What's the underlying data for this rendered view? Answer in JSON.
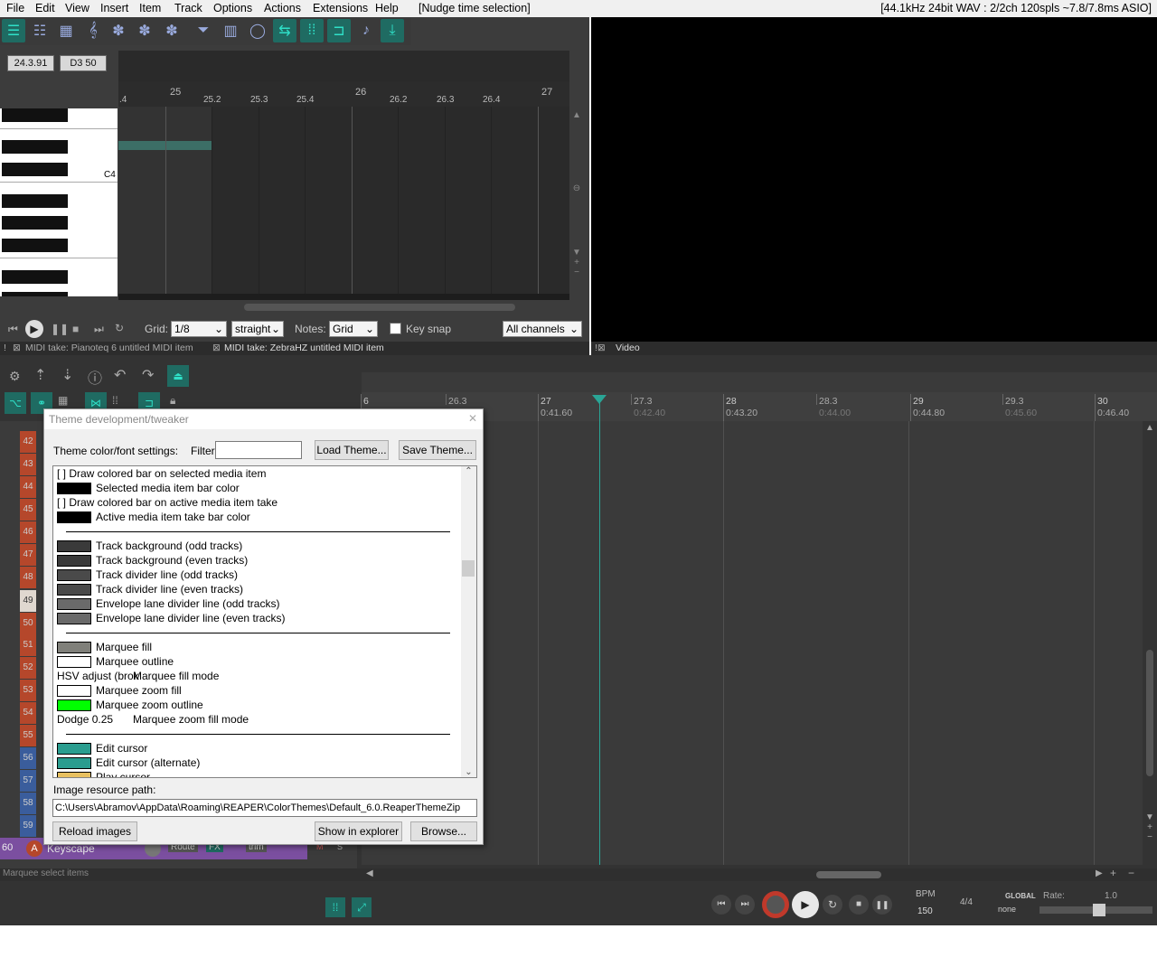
{
  "menu": {
    "items": [
      "File",
      "Edit",
      "View",
      "Insert",
      "Item",
      "Track",
      "Options",
      "Actions",
      "Extensions",
      "Help"
    ],
    "action_hint": "[Nudge time selection]",
    "audio_status": "[44.1kHz 24bit WAV : 2/2ch 120spls ~7.8/7.8ms ASIO]"
  },
  "midi_editor": {
    "position": "24.3.91",
    "note": "D3  50",
    "ruler": [
      "25",
      "25.2",
      "25.3",
      "25.4",
      "26",
      "26.2",
      "26.3",
      "26.4",
      "27"
    ],
    "ruler_partial": ".4",
    "key_label": "C4",
    "grid_label": "Grid:",
    "grid_value": "1/8",
    "grid_type": "straight",
    "notes_label": "Notes:",
    "notes_value": "Grid",
    "key_snap": "Key snap",
    "channels": "All channels"
  },
  "tabs_midi": [
    "MIDI take: Pianoteq 6 untitled MIDI item",
    "MIDI take: ZebraHZ untitled MIDI item"
  ],
  "tab_video": "Video",
  "timeline": {
    "marks": [
      {
        "bar": "6",
        "time": ""
      },
      {
        "bar": "26.3",
        "time": ""
      },
      {
        "bar": "27",
        "time": "0:41.60"
      },
      {
        "bar": "27.3",
        "time": "0:42.40"
      },
      {
        "bar": "28",
        "time": "0:43.20"
      },
      {
        "bar": "28.3",
        "time": "0:44.00"
      },
      {
        "bar": "29",
        "time": "0:44.80"
      },
      {
        "bar": "29.3",
        "time": "0:45.60"
      },
      {
        "bar": "30",
        "time": "0:46.40"
      }
    ]
  },
  "tracks": [
    "42",
    "43",
    "44",
    "45",
    "46",
    "47",
    "48",
    "49",
    "50",
    "51",
    "52",
    "53",
    "54",
    "55",
    "56",
    "57",
    "58",
    "59",
    "60"
  ],
  "track60": {
    "name": "Keyscape",
    "route": "Route",
    "fx": "FX",
    "trim": "trim",
    "m": "M",
    "s": "S"
  },
  "dialog": {
    "title": "Theme development/tweaker",
    "settings_label": "Theme color/font settings:",
    "filter_label": "Filter:",
    "filter_value": "",
    "load_btn": "Load Theme...",
    "save_btn": "Save Theme...",
    "rows": [
      {
        "kind": "check",
        "text": "[ ]  Draw colored bar on selected media item"
      },
      {
        "kind": "color",
        "color": "#000000",
        "text": "Selected media item bar color"
      },
      {
        "kind": "check",
        "text": "[ ]  Draw colored bar on active media item take"
      },
      {
        "kind": "color",
        "color": "#000000",
        "text": "Active media item take bar color"
      },
      {
        "kind": "sep"
      },
      {
        "kind": "color",
        "color": "#3a3a3a",
        "text": "Track background (odd tracks)"
      },
      {
        "kind": "color",
        "color": "#3a3a3a",
        "text": "Track background (even tracks)"
      },
      {
        "kind": "color",
        "color": "#4a4a4a",
        "text": "Track divider line (odd tracks)"
      },
      {
        "kind": "color",
        "color": "#4a4a4a",
        "text": "Track divider line (even tracks)"
      },
      {
        "kind": "color",
        "color": "#6a6a6a",
        "text": "Envelope lane divider line (odd tracks)"
      },
      {
        "kind": "color",
        "color": "#6a6a6a",
        "text": "Envelope lane divider line (even tracks)"
      },
      {
        "kind": "sep"
      },
      {
        "kind": "color",
        "color": "#80807a",
        "text": "Marquee fill"
      },
      {
        "kind": "color",
        "color": "#ffffff",
        "text": "Marquee outline"
      },
      {
        "kind": "text",
        "prefix": "HSV adjust (brok",
        "text": "Marquee fill mode"
      },
      {
        "kind": "color",
        "color": "#ffffff",
        "text": "Marquee zoom fill"
      },
      {
        "kind": "color",
        "color": "#00ff00",
        "text": "Marquee zoom outline"
      },
      {
        "kind": "text",
        "prefix": "Dodge 0.25",
        "text": "Marquee zoom fill mode"
      },
      {
        "kind": "sep"
      },
      {
        "kind": "color",
        "color": "#2a9d8f",
        "text": "Edit cursor"
      },
      {
        "kind": "color",
        "color": "#2a9d8f",
        "text": "Edit cursor (alternate)"
      },
      {
        "kind": "color",
        "color": "#e8c060",
        "text": "Play cursor"
      }
    ],
    "path_label": "Image resource path:",
    "path_value": "C:\\Users\\Abramov\\AppData\\Roaming\\REAPER\\ColorThemes\\Default_6.0.ReaperThemeZip",
    "reload_btn": "Reload images",
    "explorer_btn": "Show in explorer",
    "browse_btn": "Browse..."
  },
  "status_text": "Marquee select items",
  "transport": {
    "bpm_label": "BPM",
    "bpm": "150",
    "sig": "4/4",
    "global": "GLOBAL",
    "global_val": "none",
    "rate_label": "Rate:",
    "rate": "1.0"
  },
  "colors": {
    "accent": "#2aa596",
    "record": "#c0392b"
  }
}
